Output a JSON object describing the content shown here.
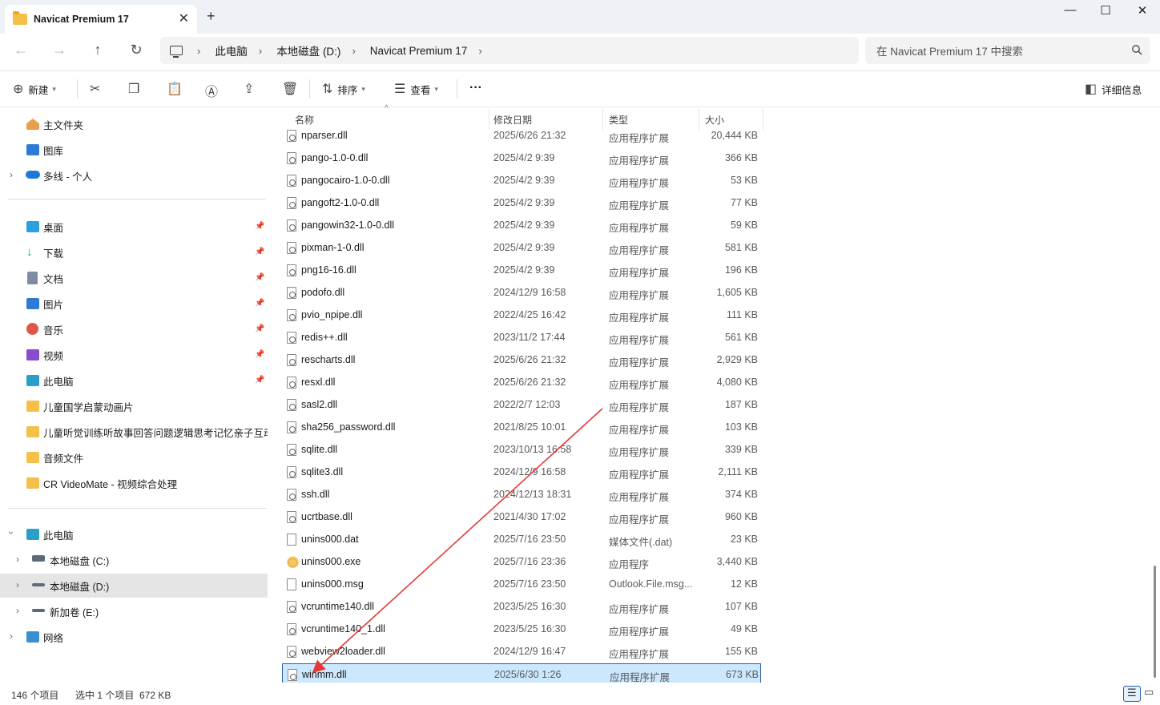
{
  "window": {
    "tab_title": "Navicat Premium 17",
    "tab_close": "✕",
    "new_tab": "+",
    "minimize": "—",
    "maximize": "☐",
    "close": "✕"
  },
  "nav": {
    "back": "←",
    "forward": "→",
    "up": "↑",
    "refresh": "↻",
    "breadcrumb": [
      "此电脑",
      "本地磁盘 (D:)",
      "Navicat Premium 17"
    ],
    "separator": "›",
    "search_placeholder": "在 Navicat Premium 17 中搜索"
  },
  "toolbar": {
    "new_label": "新建",
    "sort_label": "排序",
    "view_label": "查看",
    "more": "···",
    "details_label": "详细信息"
  },
  "sidebar": {
    "quick": [
      {
        "label": "主文件夹",
        "icon": "home-icon"
      },
      {
        "label": "图库",
        "icon": "gallery-icon"
      },
      {
        "label": "多线 - 个人",
        "icon": "onedrive-icon"
      }
    ],
    "pinned": [
      {
        "label": "桌面",
        "icon": "desktop-icon"
      },
      {
        "label": "下载",
        "icon": "download-icon"
      },
      {
        "label": "文档",
        "icon": "documents-icon"
      },
      {
        "label": "图片",
        "icon": "pictures-icon"
      },
      {
        "label": "音乐",
        "icon": "music-icon"
      },
      {
        "label": "视频",
        "icon": "videos-icon"
      },
      {
        "label": "此电脑",
        "icon": "this-pc-icon"
      }
    ],
    "folders": [
      {
        "label": "儿童国学启蒙动画片"
      },
      {
        "label": "儿童听觉训练听故事回答问题逻辑思考记忆亲子互动"
      },
      {
        "label": "音频文件"
      },
      {
        "label": "CR VideoMate - 视频综合处理"
      }
    ],
    "this_pc": "此电脑",
    "drives": [
      {
        "label": "本地磁盘 (C:)"
      },
      {
        "label": "本地磁盘 (D:)"
      },
      {
        "label": "新加卷 (E:)"
      }
    ],
    "network": "网络"
  },
  "columns": {
    "name": "名称",
    "date": "修改日期",
    "type": "类型",
    "size": "大小"
  },
  "files": [
    {
      "name": "nparser.dll",
      "date": "2025/6/26 21:32",
      "type": "应用程序扩展",
      "size": "20,444 KB",
      "icon": "dll"
    },
    {
      "name": "pango-1.0-0.dll",
      "date": "2025/4/2 9:39",
      "type": "应用程序扩展",
      "size": "366 KB",
      "icon": "dll"
    },
    {
      "name": "pangocairo-1.0-0.dll",
      "date": "2025/4/2 9:39",
      "type": "应用程序扩展",
      "size": "53 KB",
      "icon": "dll"
    },
    {
      "name": "pangoft2-1.0-0.dll",
      "date": "2025/4/2 9:39",
      "type": "应用程序扩展",
      "size": "77 KB",
      "icon": "dll"
    },
    {
      "name": "pangowin32-1.0-0.dll",
      "date": "2025/4/2 9:39",
      "type": "应用程序扩展",
      "size": "59 KB",
      "icon": "dll"
    },
    {
      "name": "pixman-1-0.dll",
      "date": "2025/4/2 9:39",
      "type": "应用程序扩展",
      "size": "581 KB",
      "icon": "dll"
    },
    {
      "name": "png16-16.dll",
      "date": "2025/4/2 9:39",
      "type": "应用程序扩展",
      "size": "196 KB",
      "icon": "dll"
    },
    {
      "name": "podofo.dll",
      "date": "2024/12/9 16:58",
      "type": "应用程序扩展",
      "size": "1,605 KB",
      "icon": "dll"
    },
    {
      "name": "pvio_npipe.dll",
      "date": "2022/4/25 16:42",
      "type": "应用程序扩展",
      "size": "111 KB",
      "icon": "dll"
    },
    {
      "name": "redis++.dll",
      "date": "2023/11/2 17:44",
      "type": "应用程序扩展",
      "size": "561 KB",
      "icon": "dll"
    },
    {
      "name": "rescharts.dll",
      "date": "2025/6/26 21:32",
      "type": "应用程序扩展",
      "size": "2,929 KB",
      "icon": "dll"
    },
    {
      "name": "resxl.dll",
      "date": "2025/6/26 21:32",
      "type": "应用程序扩展",
      "size": "4,080 KB",
      "icon": "dll"
    },
    {
      "name": "sasl2.dll",
      "date": "2022/2/7 12:03",
      "type": "应用程序扩展",
      "size": "187 KB",
      "icon": "dll"
    },
    {
      "name": "sha256_password.dll",
      "date": "2021/8/25 10:01",
      "type": "应用程序扩展",
      "size": "103 KB",
      "icon": "dll"
    },
    {
      "name": "sqlite.dll",
      "date": "2023/10/13 16:58",
      "type": "应用程序扩展",
      "size": "339 KB",
      "icon": "dll"
    },
    {
      "name": "sqlite3.dll",
      "date": "2024/12/9 16:58",
      "type": "应用程序扩展",
      "size": "2,111 KB",
      "icon": "dll"
    },
    {
      "name": "ssh.dll",
      "date": "2024/12/13 18:31",
      "type": "应用程序扩展",
      "size": "374 KB",
      "icon": "dll"
    },
    {
      "name": "ucrtbase.dll",
      "date": "2021/4/30 17:02",
      "type": "应用程序扩展",
      "size": "960 KB",
      "icon": "dll"
    },
    {
      "name": "unins000.dat",
      "date": "2025/7/16 23:50",
      "type": "媒体文件(.dat)",
      "size": "23 KB",
      "icon": "file"
    },
    {
      "name": "unins000.exe",
      "date": "2025/7/16 23:36",
      "type": "应用程序",
      "size": "3,440 KB",
      "icon": "exe"
    },
    {
      "name": "unins000.msg",
      "date": "2025/7/16 23:50",
      "type": "Outlook.File.msg...",
      "size": "12 KB",
      "icon": "file"
    },
    {
      "name": "vcruntime140.dll",
      "date": "2023/5/25 16:30",
      "type": "应用程序扩展",
      "size": "107 KB",
      "icon": "dll"
    },
    {
      "name": "vcruntime140_1.dll",
      "date": "2023/5/25 16:30",
      "type": "应用程序扩展",
      "size": "49 KB",
      "icon": "dll"
    },
    {
      "name": "webview2loader.dll",
      "date": "2024/12/9 16:47",
      "type": "应用程序扩展",
      "size": "155 KB",
      "icon": "dll"
    },
    {
      "name": "winmm.dll",
      "date": "2025/6/30 1:26",
      "type": "应用程序扩展",
      "size": "673 KB",
      "icon": "dll",
      "selected": true
    }
  ],
  "status": {
    "count": "146 个项目",
    "selection": "选中 1 个项目  672 KB"
  },
  "colors": {
    "accent": "#2a5ea8",
    "selection": "#cce8ff",
    "annotation_arrow": "#e53935"
  }
}
